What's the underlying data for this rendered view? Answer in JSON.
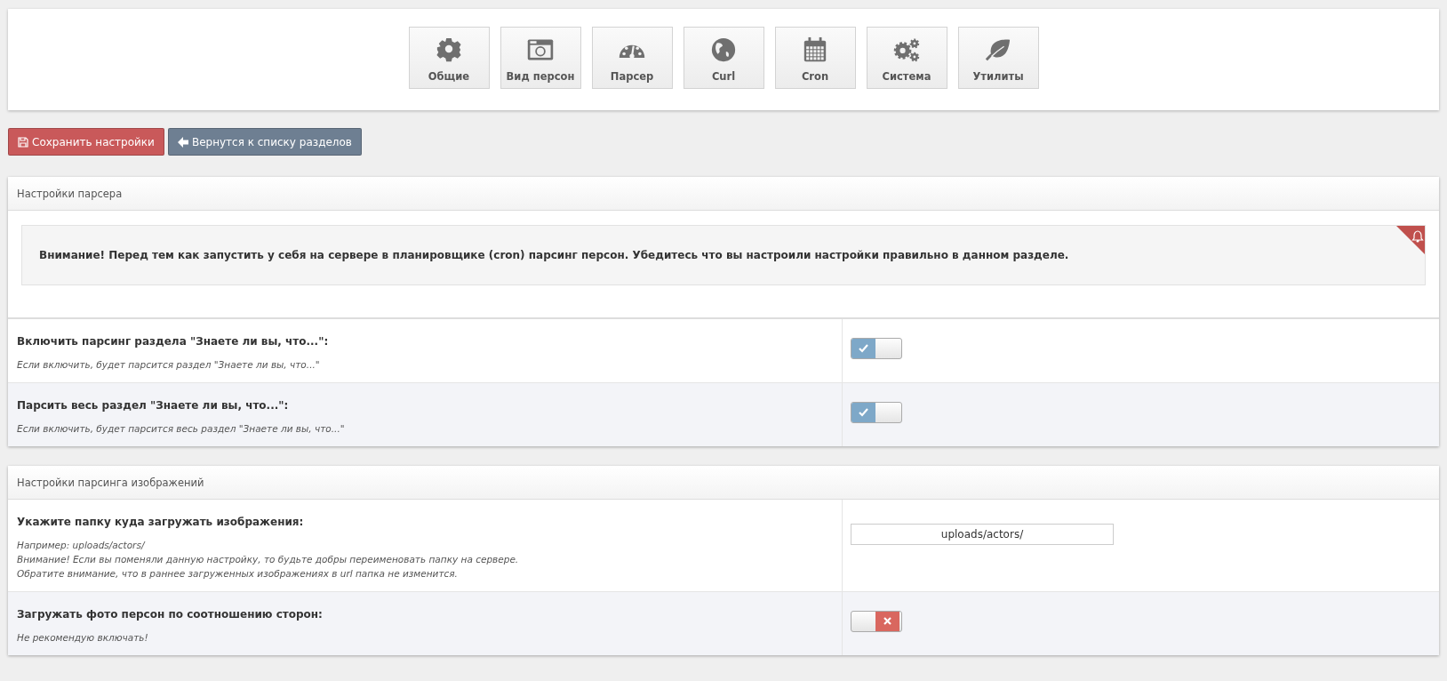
{
  "nav": [
    {
      "label": "Общие"
    },
    {
      "label": "Вид персон"
    },
    {
      "label": "Парсер"
    },
    {
      "label": "Curl"
    },
    {
      "label": "Cron"
    },
    {
      "label": "Система"
    },
    {
      "label": "Утилиты"
    }
  ],
  "actions": [
    {
      "kind": "save",
      "label": "Сохранить настройки"
    },
    {
      "kind": "back",
      "label": "Вернутся к списку разделов"
    }
  ],
  "panels": [
    {
      "title": "Настройки парсера",
      "alert": "Внимание! Перед тем как запустить у себя на сервере в планировщике (cron) парсинг персон. Убедитесь что вы настроили настройки правильно в данном разделе.",
      "rows": [
        {
          "kind": "toggle",
          "label": "Включить парсинг раздела \"Знаете ли вы, что...\":",
          "hint": [
            "Если включить, будет парсится раздел \"Знаете ли вы, что...\""
          ],
          "on": true
        },
        {
          "kind": "toggle",
          "label": "Парсить весь раздел \"Знаете ли вы, что...\":",
          "hint": [
            "Если включить, будет парсится весь раздел \"Знаете ли вы, что...\""
          ],
          "on": true
        }
      ]
    },
    {
      "title": "Настройки парсинга изображений",
      "rows": [
        {
          "kind": "text",
          "label": "Укажите папку куда загружать изображения:",
          "hint": [
            "Например: uploads/actors/",
            "Внимание! Если вы поменяли данную настройку, то будьте добры переименовать папку на сервере.",
            "Обратите внимание, что в раннее загруженных изображениях в url папка не изменится."
          ],
          "value": "uploads/actors/"
        },
        {
          "kind": "toggle",
          "label": "Загружать фото персон по соотношению сторон:",
          "hint": [
            "Не рекомендую включать!"
          ],
          "on": false
        }
      ]
    }
  ]
}
